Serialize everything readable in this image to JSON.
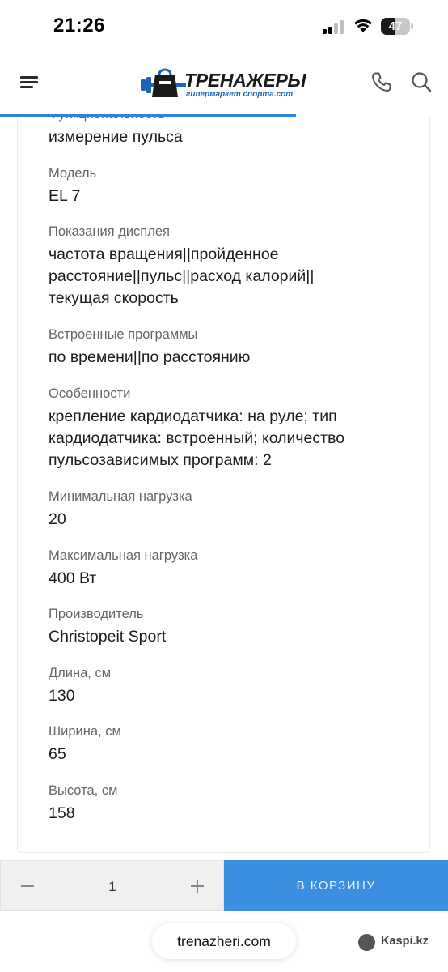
{
  "status_bar": {
    "time": "21:26",
    "battery_level": "47",
    "battery_fraction": 0.47
  },
  "header": {
    "logo_title": "ТРЕНАЖЕРЫ",
    "logo_subtitle": "гипермаркет спорта.com",
    "icons": [
      "menu-icon",
      "phone-icon",
      "search-icon"
    ],
    "accent_color": "#2f86d8",
    "scroll_progress": 0.66
  },
  "specs": [
    {
      "label": "Функциональность",
      "value": "измерение пульса"
    },
    {
      "label": "Модель",
      "value": "EL 7"
    },
    {
      "label": "Показания дисплея",
      "value_lines": [
        "частота вращения||пройденное",
        "расстояние||пульс||расход калорий||",
        "текущая скорость"
      ]
    },
    {
      "label": "Встроенные программы",
      "value": "по времени||по расстоянию"
    },
    {
      "label": "Особенности",
      "value_lines": [
        "крепление кардиодатчика: на руле; тип",
        "кардиодатчика: встроенный; количество",
        "пульсозависимых программ: 2"
      ]
    },
    {
      "label": "Минимальная нагрузка",
      "value": "20"
    },
    {
      "label": "Максимальная нагрузка",
      "value": "400 Вт"
    },
    {
      "label": "Производитель",
      "value": "Christopeit Sport"
    },
    {
      "label": "Длина, см",
      "value": "130"
    },
    {
      "label": "Ширина, см",
      "value": "65"
    },
    {
      "label": "Высота, см",
      "value": "158"
    }
  ],
  "cart": {
    "quantity": "1",
    "minus_icon": "minus-icon",
    "plus_icon": "plus-icon",
    "add_button_label": "В КОРЗИНУ",
    "button_color": "#3b8ee0"
  },
  "browser": {
    "url": "trenazheri.com"
  },
  "watermark": {
    "text": "Kaspi.kz"
  }
}
